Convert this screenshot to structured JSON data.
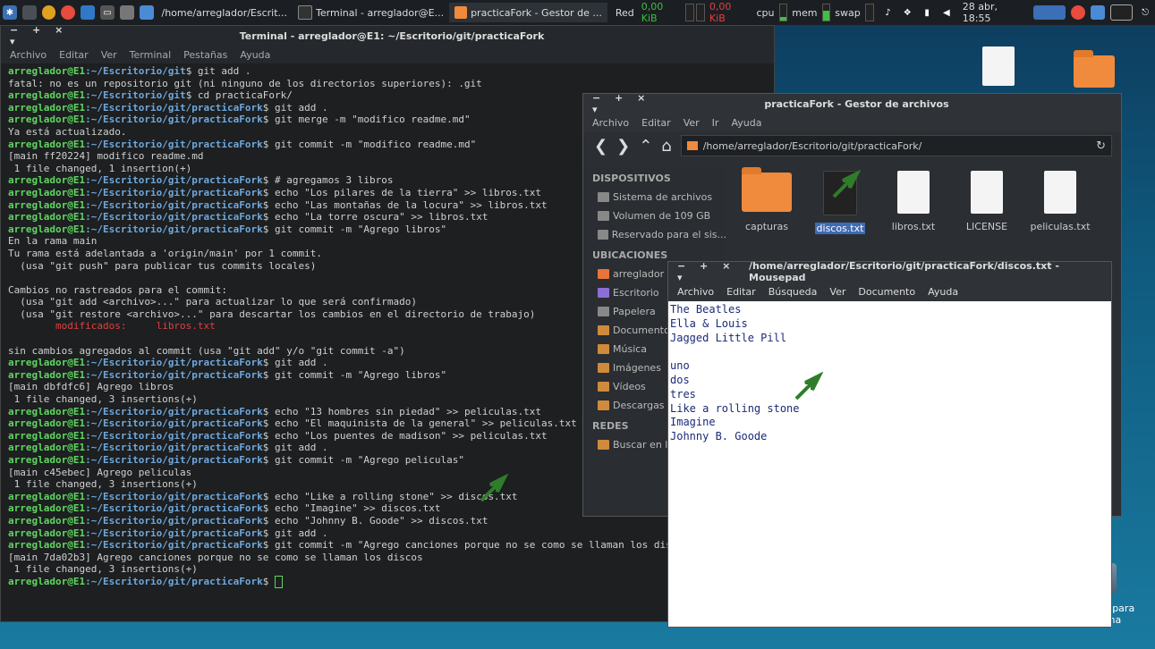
{
  "panel": {
    "tasks": [
      {
        "label": "/home/arreglador/Escrit..."
      },
      {
        "label": "Terminal - arreglador@E..."
      },
      {
        "label": "practicaFork - Gestor de ..."
      }
    ],
    "net_label": "Red",
    "net_in": "0,00  KiB",
    "net_out": "0,00  KiB",
    "cpu_label": "cpu",
    "mem_label": "mem",
    "swap_label": "swap",
    "clock": "28 abr, 18:55"
  },
  "terminal": {
    "title": "Terminal - arreglador@E1: ~/Escritorio/git/practicaFork",
    "controls": "− + × ▾",
    "menu": [
      "Archivo",
      "Editar",
      "Ver",
      "Terminal",
      "Pestañas",
      "Ayuda"
    ],
    "lines": [
      {
        "p": "arreglador@E1",
        "path": ":~/Escritorio/git",
        "cmd": "$ git add ."
      },
      {
        "t": "fatal: no es un repositorio git (ni ninguno de los directorios superiores): .git"
      },
      {
        "p": "arreglador@E1",
        "path": ":~/Escritorio/git",
        "cmd": "$ cd practicaFork/"
      },
      {
        "p": "arreglador@E1",
        "path": ":~/Escritorio/git/practicaFork",
        "cmd": "$ git add ."
      },
      {
        "p": "arreglador@E1",
        "path": ":~/Escritorio/git/practicaFork",
        "cmd": "$ git merge -m \"modifico readme.md\""
      },
      {
        "t": "Ya está actualizado."
      },
      {
        "p": "arreglador@E1",
        "path": ":~/Escritorio/git/practicaFork",
        "cmd": "$ git commit -m \"modifico readme.md\""
      },
      {
        "t": "[main ff20224] modifico readme.md"
      },
      {
        "t": " 1 file changed, 1 insertion(+)"
      },
      {
        "p": "arreglador@E1",
        "path": ":~/Escritorio/git/practicaFork",
        "cmd": "$ # agregamos 3 libros"
      },
      {
        "p": "arreglador@E1",
        "path": ":~/Escritorio/git/practicaFork",
        "cmd": "$ echo \"Los pilares de la tierra\" >> libros.txt"
      },
      {
        "p": "arreglador@E1",
        "path": ":~/Escritorio/git/practicaFork",
        "cmd": "$ echo \"Las montañas de la locura\" >> libros.txt"
      },
      {
        "p": "arreglador@E1",
        "path": ":~/Escritorio/git/practicaFork",
        "cmd": "$ echo \"La torre oscura\" >> libros.txt"
      },
      {
        "p": "arreglador@E1",
        "path": ":~/Escritorio/git/practicaFork",
        "cmd": "$ git commit -m \"Agrego libros\""
      },
      {
        "t": "En la rama main"
      },
      {
        "t": "Tu rama está adelantada a 'origin/main' por 1 commit."
      },
      {
        "t": "  (usa \"git push\" para publicar tus commits locales)"
      },
      {
        "t": ""
      },
      {
        "t": "Cambios no rastreados para el commit:"
      },
      {
        "t": "  (usa \"git add <archivo>...\" para actualizar lo que será confirmado)"
      },
      {
        "t": "  (usa \"git restore <archivo>...\" para descartar los cambios en el directorio de trabajo)"
      },
      {
        "r": "\tmodificados:     libros.txt"
      },
      {
        "t": ""
      },
      {
        "t": "sin cambios agregados al commit (usa \"git add\" y/o \"git commit -a\")"
      },
      {
        "p": "arreglador@E1",
        "path": ":~/Escritorio/git/practicaFork",
        "cmd": "$ git add ."
      },
      {
        "p": "arreglador@E1",
        "path": ":~/Escritorio/git/practicaFork",
        "cmd": "$ git commit -m \"Agrego libros\""
      },
      {
        "t": "[main dbfdfc6] Agrego libros"
      },
      {
        "t": " 1 file changed, 3 insertions(+)"
      },
      {
        "p": "arreglador@E1",
        "path": ":~/Escritorio/git/practicaFork",
        "cmd": "$ echo \"13 hombres sin piedad\" >> peliculas.txt"
      },
      {
        "p": "arreglador@E1",
        "path": ":~/Escritorio/git/practicaFork",
        "cmd": "$ echo \"El maquinista de la general\" >> peliculas.txt"
      },
      {
        "p": "arreglador@E1",
        "path": ":~/Escritorio/git/practicaFork",
        "cmd": "$ echo \"Los puentes de madison\" >> peliculas.txt"
      },
      {
        "p": "arreglador@E1",
        "path": ":~/Escritorio/git/practicaFork",
        "cmd": "$ git add ."
      },
      {
        "p": "arreglador@E1",
        "path": ":~/Escritorio/git/practicaFork",
        "cmd": "$ git commit -m \"Agrego peliculas\""
      },
      {
        "t": "[main c45ebec] Agrego peliculas"
      },
      {
        "t": " 1 file changed, 3 insertions(+)"
      },
      {
        "p": "arreglador@E1",
        "path": ":~/Escritorio/git/practicaFork",
        "cmd": "$ echo \"Like a rolling stone\" >> discos.txt"
      },
      {
        "p": "arreglador@E1",
        "path": ":~/Escritorio/git/practicaFork",
        "cmd": "$ echo \"Imagine\" >> discos.txt"
      },
      {
        "p": "arreglador@E1",
        "path": ":~/Escritorio/git/practicaFork",
        "cmd": "$ echo \"Johnny B. Goode\" >> discos.txt"
      },
      {
        "p": "arreglador@E1",
        "path": ":~/Escritorio/git/practicaFork",
        "cmd": "$ git add ."
      },
      {
        "p": "arreglador@E1",
        "path": ":~/Escritorio/git/practicaFork",
        "cmd": "$ git commit -m \"Agrego canciones porque no se como se llaman los discos\""
      },
      {
        "t": "[main 7da02b3] Agrego canciones porque no se como se llaman los discos"
      },
      {
        "t": " 1 file changed, 3 insertions(+)"
      },
      {
        "p": "arreglador@E1",
        "path": ":~/Escritorio/git/practicaFork",
        "cmd": "$ ",
        "cursor": true
      }
    ]
  },
  "filemanager": {
    "title": "practicaFork - Gestor de archivos",
    "controls": "− + × ▾",
    "menu": [
      "Archivo",
      "Editar",
      "Ver",
      "Ir",
      "Ayuda"
    ],
    "address": "/home/arreglador/Escritorio/git/practicaFork/",
    "sidebar": {
      "dispositivos_header": "DISPOSITIVOS",
      "dispositivos": [
        "Sistema de archivos",
        "Volumen de 109 GB",
        "Reservado para el sis..."
      ],
      "ubicaciones_header": "UBICACIONES",
      "ubicaciones": [
        "arreglador",
        "Escritorio",
        "Papelera",
        "Documentos",
        "Música",
        "Imágenes",
        "Vídeos",
        "Descargas"
      ],
      "redes_header": "REDES",
      "redes": [
        "Buscar en la red"
      ]
    },
    "files": [
      "capturas",
      "discos.txt",
      "libros.txt",
      "LICENSE",
      "peliculas.txt"
    ]
  },
  "mousepad": {
    "title": "/home/arreglador/Escritorio/git/practicaFork/discos.txt - Mousepad",
    "controls": "− + × ▾",
    "menu": [
      "Archivo",
      "Editar",
      "Búsqueda",
      "Ver",
      "Documento",
      "Ayuda"
    ],
    "lines": [
      "The Beatles",
      "Ella & Louis",
      "Jagged Little Pill",
      "",
      "uno",
      "dos",
      "tres",
      "Like a rolling stone",
      "Imagine",
      "Johnny B. Goode"
    ]
  },
  "desktop": {
    "drive_label_1": "Reservado para",
    "drive_label_2": "el sistema"
  }
}
